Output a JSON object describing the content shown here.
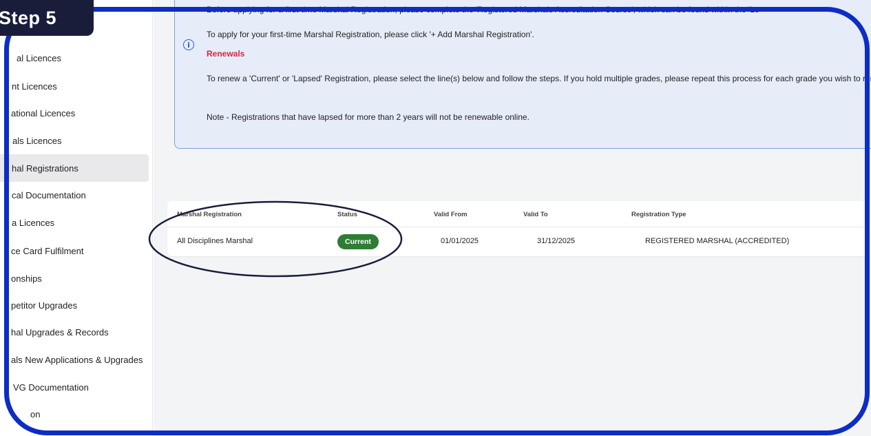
{
  "step_tag": "Step 5",
  "sidebar": {
    "items": [
      {
        "label": "al Licences",
        "active": false
      },
      {
        "label": "nt Licences",
        "active": false
      },
      {
        "label": "ational Licences",
        "active": false
      },
      {
        "label": "als Licences",
        "active": false
      },
      {
        "label": "hal Registrations",
        "active": true
      },
      {
        "label": "cal Documentation",
        "active": false
      },
      {
        "label": "a Licences",
        "active": false
      },
      {
        "label": "ce Card Fulfilment",
        "active": false
      },
      {
        "label": "onships",
        "active": false
      },
      {
        "label": "petitor Upgrades",
        "active": false
      },
      {
        "label": "hal Upgrades & Records",
        "active": false
      },
      {
        "label": "als New Applications & Upgrades",
        "active": false
      },
      {
        "label": "VG Documentation",
        "active": false
      },
      {
        "label": "on",
        "active": false
      }
    ]
  },
  "info": {
    "line1": "Before applying for a first-time Marshal Registration, please complete the 'Registered Marshals Accreditation Course', which can be found within the 'Le",
    "line2": "To apply for your first-time Marshal Registration, please click '+ Add Marshal Registration'.",
    "renewals_heading": "Renewals",
    "line3": "To renew a 'Current' or 'Lapsed' Registration, please select the line(s) below and follow the steps. If you hold multiple grades, please repeat this process for each grade you wish to renew.",
    "line4": "Note - Registrations that have lapsed for more than 2 years will not be renewable online."
  },
  "table": {
    "headers": [
      "Marshal Registration",
      "Status",
      "Valid From",
      "Valid To",
      "Registration Type"
    ],
    "rows": [
      {
        "registration": "All Disciplines Marshal",
        "status": "Current",
        "valid_from": "01/01/2025",
        "valid_to": "31/12/2025",
        "type": "REGISTERED MARSHAL (ACCREDITED)"
      }
    ]
  },
  "colors": {
    "frame": "#0d2dc4",
    "step_tag": "#1a1d3a",
    "status_current": "#2f7d32",
    "renewals": "#d7263d"
  }
}
